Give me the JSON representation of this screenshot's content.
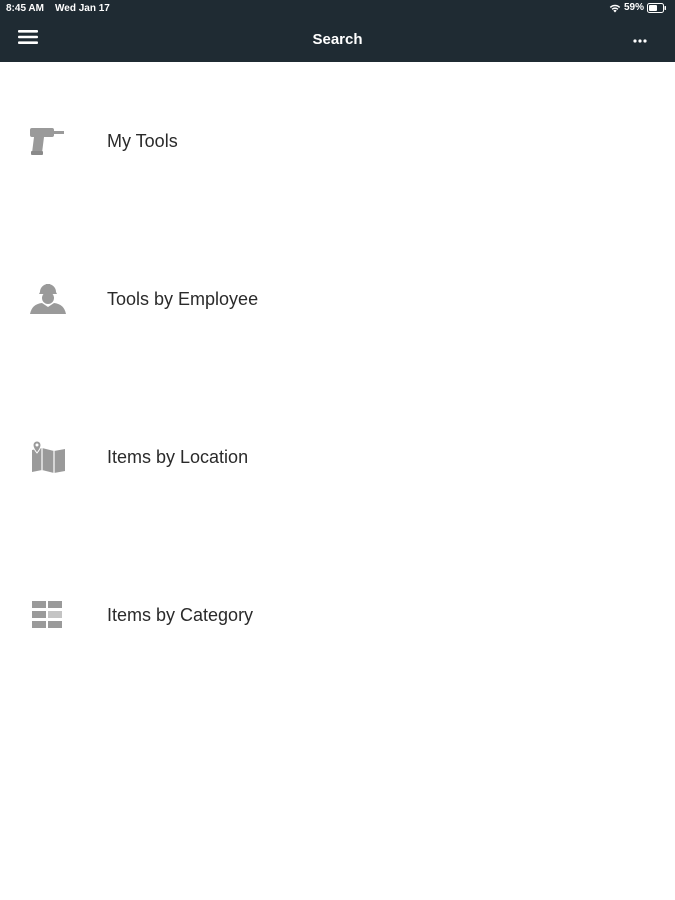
{
  "status_bar": {
    "time": "8:45 AM",
    "date": "Wed Jan 17",
    "battery": "59%"
  },
  "header": {
    "title": "Search",
    "menu_icon": "hamburger-icon",
    "more_icon": "more-horizontal-icon"
  },
  "menu": {
    "items": [
      {
        "label": "My Tools",
        "icon": "drill-icon"
      },
      {
        "label": "Tools by Employee",
        "icon": "worker-icon"
      },
      {
        "label": "Items by Location",
        "icon": "map-pin-icon"
      },
      {
        "label": "Items by Category",
        "icon": "category-grid-icon"
      }
    ]
  },
  "colors": {
    "header_bg": "#1f2b33",
    "icon_gray": "#9a9a9a",
    "text": "#2a2a2a"
  }
}
